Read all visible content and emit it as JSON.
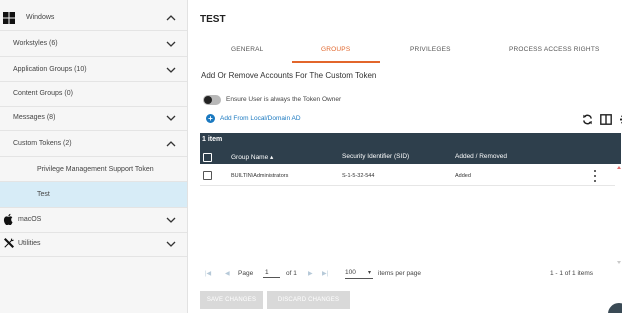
{
  "sidebar": {
    "items": [
      {
        "label": "Windows",
        "icon": "windows-logo-icon",
        "chevron": "up"
      },
      {
        "label": "Workstyles (6)",
        "chevron": "down"
      },
      {
        "label": "Application Groups (10)",
        "chevron": "down"
      },
      {
        "label": "Content Groups (0)"
      },
      {
        "label": "Messages (8)",
        "chevron": "down"
      },
      {
        "label": "Custom Tokens (2)",
        "chevron": "up"
      },
      {
        "label": "Privilege Management Support Token"
      },
      {
        "label": "Test",
        "active": true
      },
      {
        "label": "macOS",
        "icon": "apple-logo-icon",
        "chevron": "down"
      },
      {
        "label": "Utilities",
        "icon": "tools-icon",
        "chevron": "down"
      }
    ]
  },
  "main": {
    "title": "TEST",
    "tabs": [
      {
        "label": "GENERAL"
      },
      {
        "label": "GROUPS",
        "active": true
      },
      {
        "label": "PRIVILEGES"
      },
      {
        "label": "PROCESS ACCESS RIGHTS"
      }
    ],
    "heading": "Add Or Remove Accounts For The Custom Token",
    "toggle_label": "Ensure User is always the Token Owner",
    "toggle_on": false,
    "add_link": "Add From Local/Domain AD",
    "toolbar_icons": [
      "refresh-icon",
      "columns-icon",
      "gear-icon"
    ]
  },
  "grid": {
    "count": "1 item",
    "columns": [
      "Group Name ▴",
      "Security Identifier (SID)",
      "Added / Removed"
    ],
    "rows": [
      {
        "group_name": "BUILTIN\\Administrators",
        "sid": "S-1-5-32-544",
        "status": "Added"
      }
    ]
  },
  "pager": {
    "page_label": "Page",
    "page_value": "1",
    "of_label": "of 1",
    "per_page": "100",
    "per_page_label": "items per page",
    "summary": "1 - 1 of 1 items"
  },
  "buttons": {
    "save": "SAVE CHANGES",
    "discard": "DISCARD CHANGES"
  },
  "colors": {
    "accent": "#e2662b",
    "link": "#1b79c0",
    "grid_header": "#2e3f4c",
    "active_sidebar": "#d7ecf7",
    "disabled_button": "#d9d9d9"
  }
}
